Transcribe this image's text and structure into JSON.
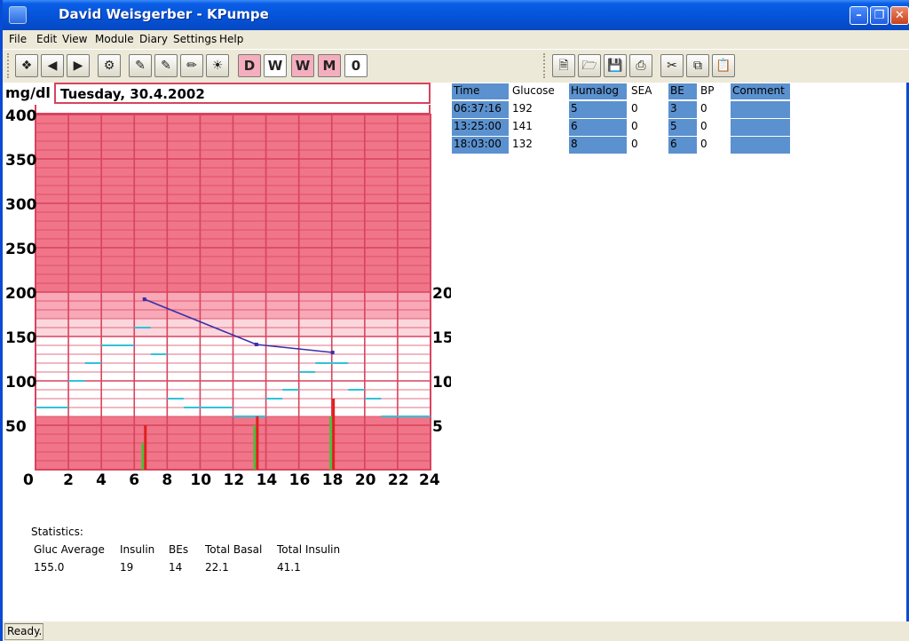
{
  "window": {
    "title": "David Weisgerber - KPumpe"
  },
  "menu": [
    "File",
    "Edit",
    "View",
    "Module",
    "Diary",
    "Settings",
    "Help"
  ],
  "toolbar": {
    "view_buttons": [
      "D",
      "W",
      "W",
      "M",
      "0"
    ]
  },
  "chart": {
    "unit": "mg/dl",
    "date": "Tuesday, 30.4.2002",
    "left_ticks": [
      "400",
      "350",
      "300",
      "250",
      "200",
      "150",
      "100",
      "50"
    ],
    "right_ticks": [
      "20",
      "15",
      "10",
      "5"
    ],
    "x_ticks": [
      "0",
      "2",
      "4",
      "6",
      "8",
      "10",
      "12",
      "14",
      "16",
      "18",
      "20",
      "22",
      "24"
    ]
  },
  "chart_data": {
    "type": "line",
    "ylim_left": [
      0,
      400
    ],
    "ylim_right": [
      0,
      25
    ],
    "xlim": [
      0,
      24
    ],
    "glucose_series": [
      {
        "x": 6.62,
        "y": 192
      },
      {
        "x": 13.42,
        "y": 141
      },
      {
        "x": 18.05,
        "y": 132
      }
    ],
    "basal_segments": [
      {
        "x0": 0,
        "x1": 2,
        "y": 7
      },
      {
        "x0": 2,
        "x1": 3,
        "y": 10
      },
      {
        "x0": 3,
        "x1": 4,
        "y": 12
      },
      {
        "x0": 4,
        "x1": 6,
        "y": 14
      },
      {
        "x0": 6,
        "x1": 7,
        "y": 16
      },
      {
        "x0": 7,
        "x1": 8,
        "y": 13
      },
      {
        "x0": 8,
        "x1": 9,
        "y": 8
      },
      {
        "x0": 9,
        "x1": 10,
        "y": 7
      },
      {
        "x0": 10,
        "x1": 12,
        "y": 7
      },
      {
        "x0": 12,
        "x1": 14,
        "y": 6
      },
      {
        "x0": 14,
        "x1": 15,
        "y": 8
      },
      {
        "x0": 15,
        "x1": 16,
        "y": 9
      },
      {
        "x0": 16,
        "x1": 17,
        "y": 11
      },
      {
        "x0": 17,
        "x1": 19,
        "y": 12
      },
      {
        "x0": 19,
        "x1": 20,
        "y": 9
      },
      {
        "x0": 20,
        "x1": 21,
        "y": 8
      },
      {
        "x0": 21,
        "x1": 22,
        "y": 6
      },
      {
        "x0": 22,
        "x1": 24,
        "y": 6
      }
    ],
    "bolus_bars": [
      {
        "x": 6.62,
        "insulin": 5,
        "be": 3
      },
      {
        "x": 13.42,
        "insulin": 6,
        "be": 5
      },
      {
        "x": 18.05,
        "insulin": 8,
        "be": 6
      }
    ],
    "colors": {
      "band_high": "#f07588",
      "band_mid": "#f8a8b6",
      "band_light": "#fcd6dd",
      "band_target": "#ffffff",
      "band_low": "#f07588",
      "grid": "#d8435e",
      "glucose_line": "#3a2ea8",
      "basal": "#33c1d9",
      "insulin_bar": "#e02020",
      "be_bar": "#4cbf3c"
    }
  },
  "table": {
    "headers": [
      "Time",
      "Glucose",
      "Humalog",
      "SEA",
      "BE",
      "BP",
      "Comment"
    ],
    "rows": [
      [
        "06:37:16",
        "192",
        "5",
        "0",
        "3",
        "0",
        ""
      ],
      [
        "13:25:00",
        "141",
        "6",
        "0",
        "5",
        "0",
        ""
      ],
      [
        "18:03:00",
        "132",
        "8",
        "0",
        "6",
        "0",
        ""
      ]
    ]
  },
  "stats": {
    "title": "Statistics:",
    "labels": [
      "Gluc Average",
      "Insulin",
      "BEs",
      "Total Basal",
      "Total Insulin"
    ],
    "values": [
      "155.0",
      "19",
      "14",
      "22.1",
      "41.1"
    ]
  },
  "status": {
    "text": "Ready."
  }
}
